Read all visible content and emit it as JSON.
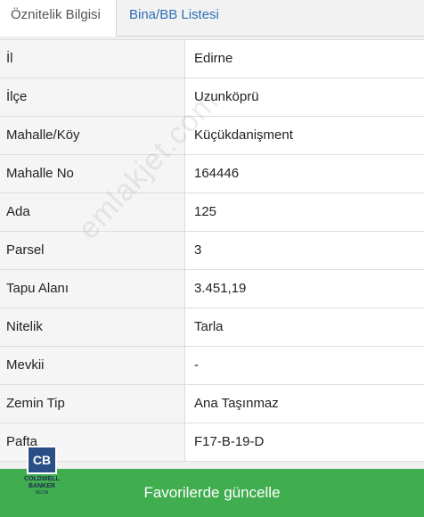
{
  "tabs": [
    {
      "label": "Öznitelik Bilgisi"
    },
    {
      "label": "Bina/BB Listesi"
    }
  ],
  "rows": [
    {
      "key": "İl",
      "value": "Edirne"
    },
    {
      "key": "İlçe",
      "value": "Uzunköprü"
    },
    {
      "key": "Mahalle/Köy",
      "value": "Küçükdanişment"
    },
    {
      "key": "Mahalle No",
      "value": "164446"
    },
    {
      "key": "Ada",
      "value": "125"
    },
    {
      "key": "Parsel",
      "value": "3"
    },
    {
      "key": "Tapu Alanı",
      "value": "3.451,19"
    },
    {
      "key": "Nitelik",
      "value": "Tarla"
    },
    {
      "key": "Mevkii",
      "value": "-"
    },
    {
      "key": "Zemin Tip",
      "value": "Ana Taşınmaz"
    },
    {
      "key": "Pafta",
      "value": "F17-B-19-D"
    }
  ],
  "watermark": "emlakjet.com",
  "logo": {
    "mark": "CB",
    "line1": "COLDWELL",
    "line2": "BANKER",
    "line3": "NEON"
  },
  "footer": {
    "button_label": "Favorilerde güncelle"
  },
  "colors": {
    "accent_green": "#40ad4e",
    "tab_link_blue": "#2f6fb3"
  }
}
